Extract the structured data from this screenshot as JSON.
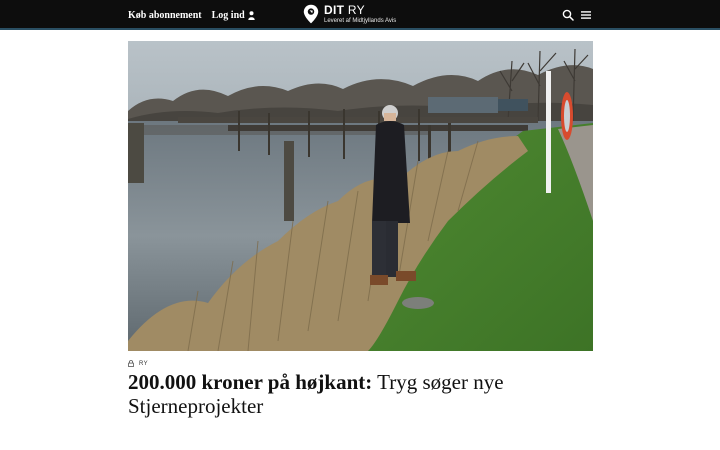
{
  "header": {
    "subscribe_label": "Køb abonnement",
    "login_label": "Log ind",
    "brand_name_bold": "DIT",
    "brand_name_light": " RY",
    "brand_tagline": "Leveret af Midtjyllands Avis",
    "icons": [
      "user-icon",
      "location-pin-icon",
      "search-icon",
      "menu-icon"
    ]
  },
  "article": {
    "section": "RY",
    "locked": true,
    "kicker": "200.000 kroner på højkant:",
    "title": " Tryg søger nye Stjerneprojekter"
  },
  "colors": {
    "topbar_bg": "#0d0d0d",
    "topbar_border": "#2a4f63",
    "text": "#111111"
  }
}
